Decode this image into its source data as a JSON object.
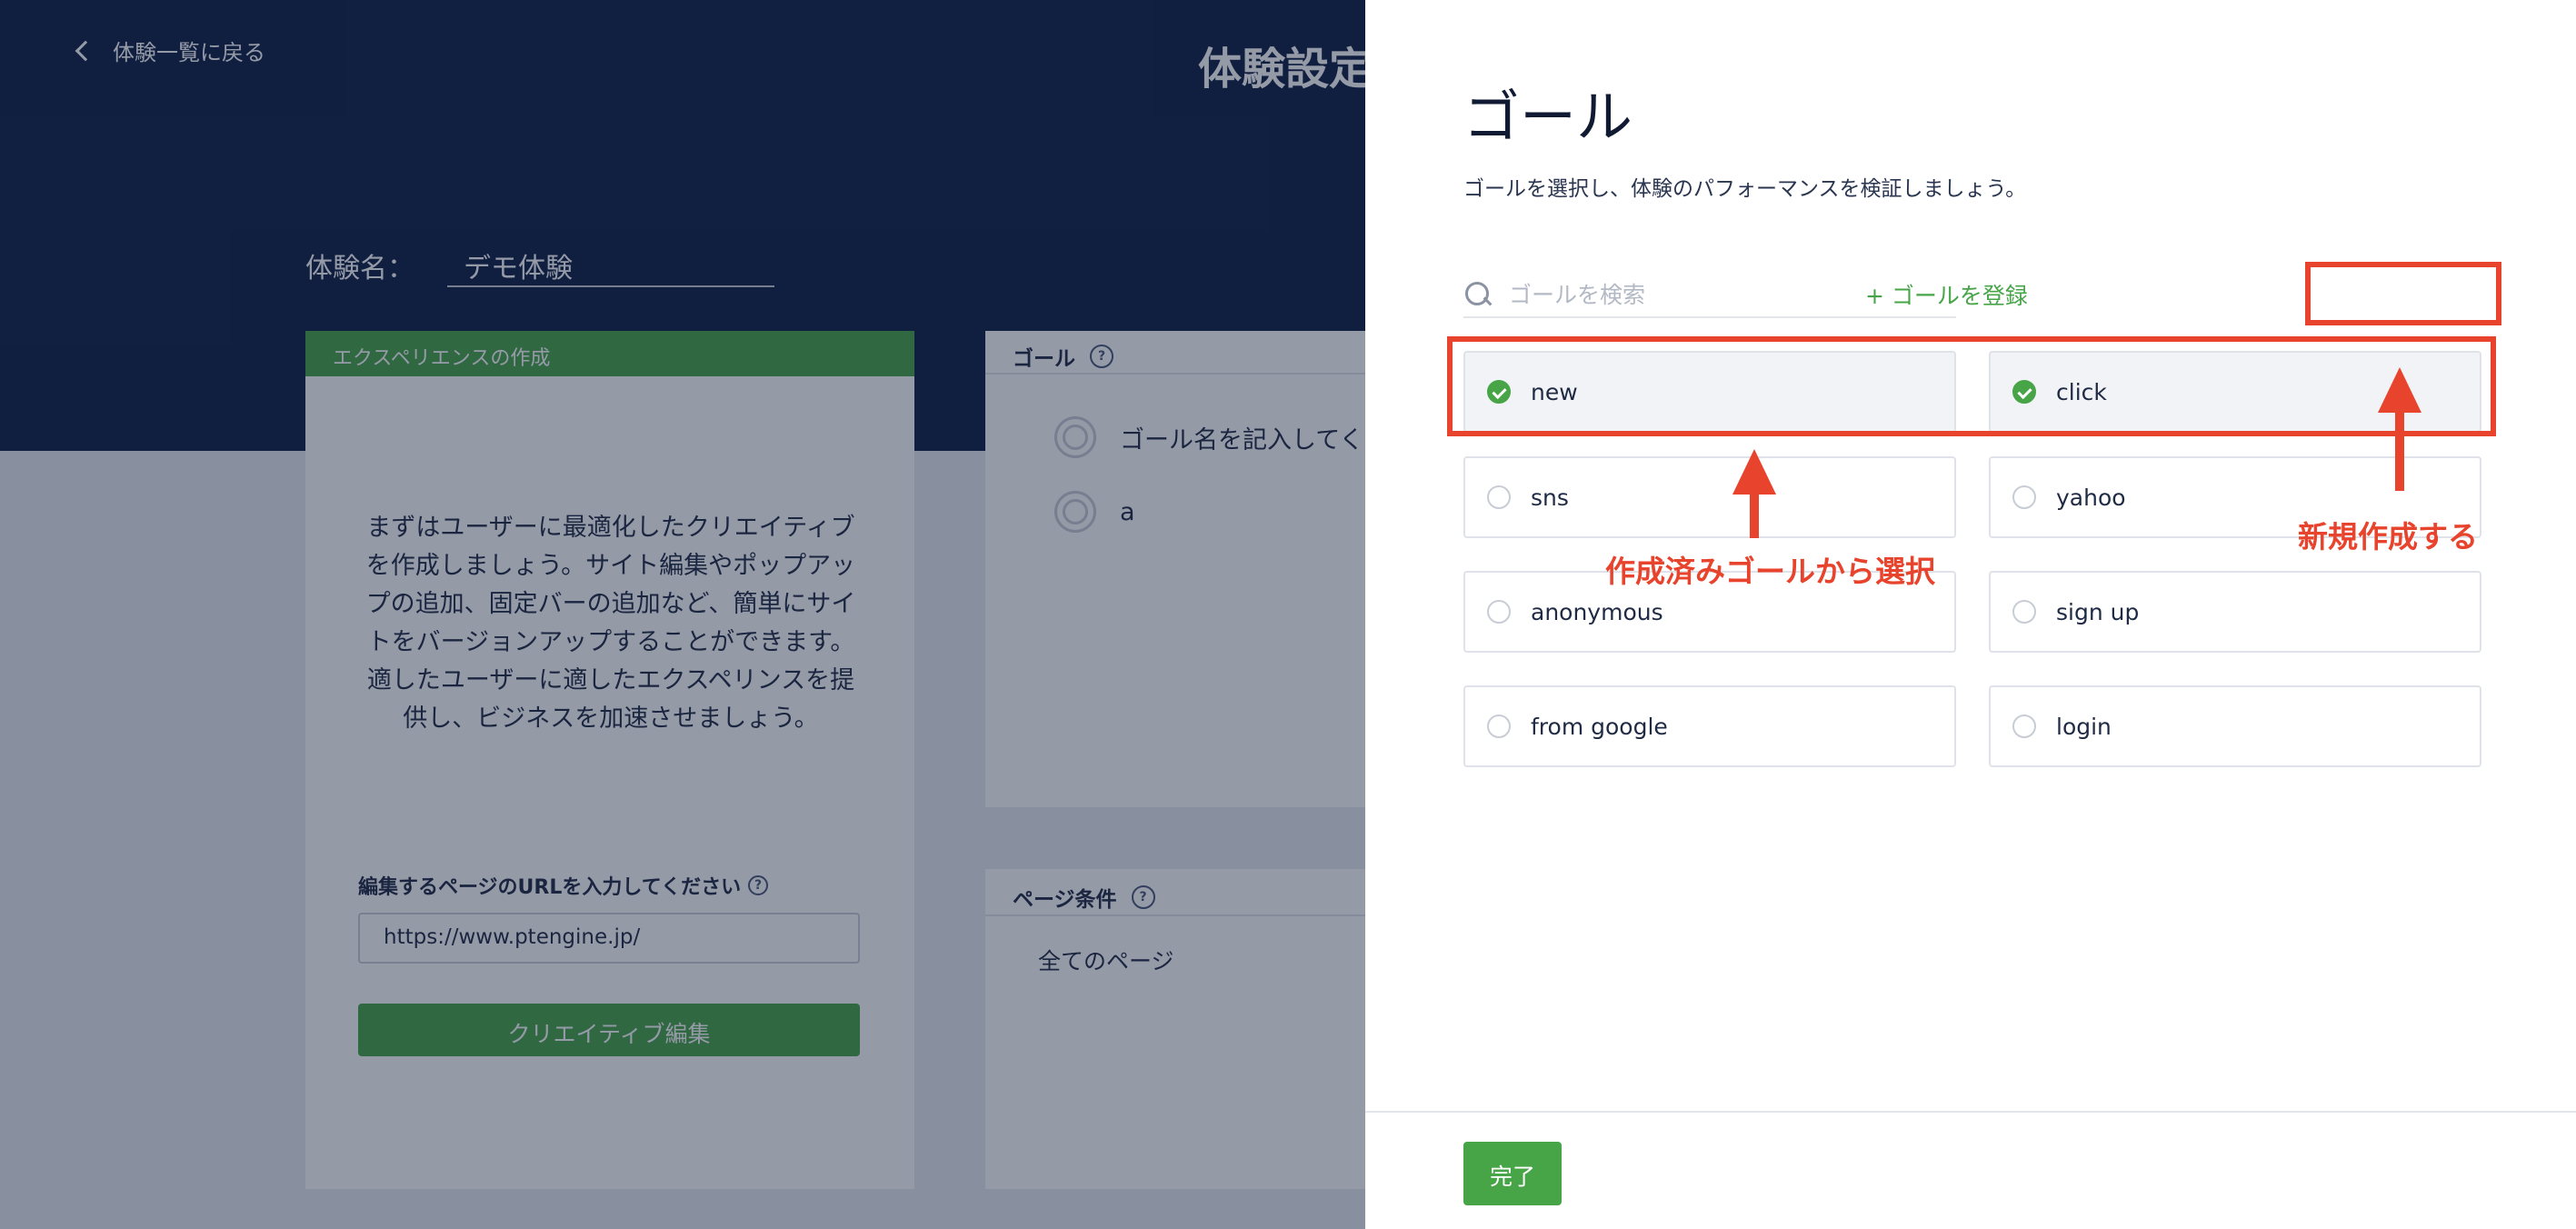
{
  "background": {
    "back_label": "体験一覧に戻る",
    "page_title": "体験設定",
    "experience_name_label": "体験名：",
    "experience_name_value": "デモ体験",
    "experience_card": {
      "header": "エクスペリエンスの作成",
      "description": "まずはユーザーに最適化したクリエイティブを作成しましょう。サイト編集やポップアップの追加、固定バーの追加など、簡単にサイトをバージョンアップすることができます。適したユーザーに適したエクスペリンスを提供し、ビジネスを加速させましょう。",
      "url_label": "編集するページのURLを入力してください",
      "url_value": "https://www.ptengine.jp/",
      "edit_button": "クリエイティブ編集"
    },
    "goal_card": {
      "header": "ゴール",
      "rows": [
        "ゴール名を記入してくだ",
        "a"
      ]
    },
    "page_card": {
      "header": "ページ条件",
      "value": "全てのページ"
    }
  },
  "panel": {
    "title": "ゴール",
    "description": "ゴールを選択し、体験のパフォーマンスを検証しましょう。",
    "search_placeholder": "ゴールを検索",
    "register_label": "+ ゴールを登録",
    "goals": [
      {
        "label": "new",
        "selected": true
      },
      {
        "label": "click",
        "selected": true
      },
      {
        "label": "sns",
        "selected": false
      },
      {
        "label": "yahoo",
        "selected": false
      },
      {
        "label": "anonymous",
        "selected": false
      },
      {
        "label": "sign up",
        "selected": false
      },
      {
        "label": "from google",
        "selected": false
      },
      {
        "label": "login",
        "selected": false
      }
    ],
    "done_button": "完了"
  },
  "annotations": {
    "select_existing": "作成済みゴールから選択",
    "create_new": "新規作成する"
  },
  "colors": {
    "header_bg": "#0e1f44",
    "accent_green": "#47a447",
    "annotation_red": "#e8432c"
  }
}
